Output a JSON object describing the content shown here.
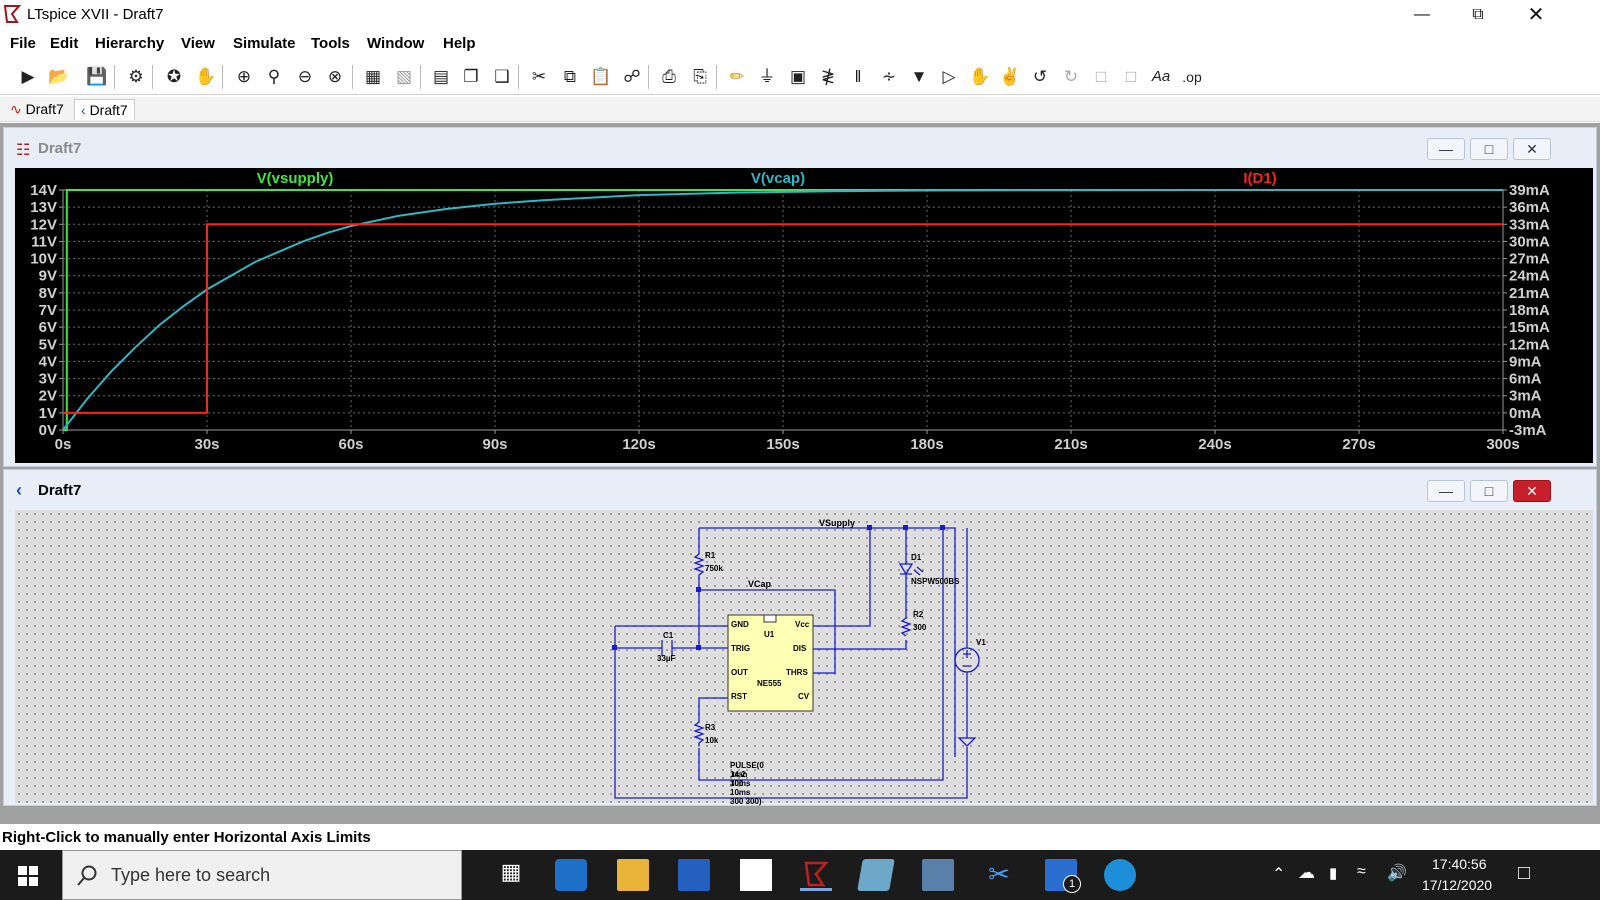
{
  "window": {
    "title": "LTspice XVII - Draft7"
  },
  "menu": [
    "File",
    "Edit",
    "Hierarchy",
    "View",
    "Simulate",
    "Tools",
    "Window",
    "Help"
  ],
  "tabs": [
    {
      "label": "Draft7",
      "kind": "waveform"
    },
    {
      "label": "Draft7",
      "kind": "schematic"
    }
  ],
  "waveform_window": {
    "title": "Draft7"
  },
  "schematic_window": {
    "title": "Draft7"
  },
  "chart_data": {
    "type": "line",
    "series": [
      {
        "name": "V(vsupply)",
        "color": "#3ee83e",
        "axis": "left",
        "x": [
          0,
          0.8,
          0.8,
          300
        ],
        "values": [
          0,
          0,
          14,
          14
        ]
      },
      {
        "name": "V(vcap)",
        "color": "#2fb7c4",
        "axis": "left",
        "x": [
          0,
          5,
          10,
          15,
          20,
          25,
          30,
          35,
          40,
          45,
          50,
          55,
          60,
          70,
          80,
          90,
          100,
          120,
          140,
          160,
          180,
          200,
          240,
          300
        ],
        "values": [
          0,
          1.8,
          3.4,
          4.8,
          6.1,
          7.2,
          8.2,
          9.0,
          9.8,
          10.4,
          11.0,
          11.5,
          11.9,
          12.5,
          12.9,
          13.2,
          13.4,
          13.7,
          13.85,
          13.93,
          13.97,
          13.99,
          14,
          14
        ]
      },
      {
        "name": "I(D1)",
        "color": "#ff2020",
        "axis": "right",
        "x": [
          0,
          0.8,
          0.8,
          30,
          30,
          300
        ],
        "values": [
          0,
          0,
          0,
          0,
          33,
          33
        ]
      }
    ],
    "x_ticks": [
      "0s",
      "30s",
      "60s",
      "90s",
      "120s",
      "150s",
      "180s",
      "210s",
      "240s",
      "270s",
      "300s"
    ],
    "xlim": [
      0,
      300
    ],
    "left_ticks": [
      "14V",
      "13V",
      "12V",
      "11V",
      "10V",
      "9V",
      "8V",
      "7V",
      "6V",
      "5V",
      "4V",
      "3V",
      "2V",
      "1V",
      "0V"
    ],
    "ylim_left": [
      0,
      14
    ],
    "right_ticks": [
      "39mA",
      "36mA",
      "33mA",
      "30mA",
      "27mA",
      "24mA",
      "21mA",
      "18mA",
      "15mA",
      "12mA",
      "9mA",
      "6mA",
      "3mA",
      "0mA",
      "-3mA"
    ],
    "ylim_right": [
      -3,
      39
    ],
    "grid": true,
    "legend": "top"
  },
  "schematic": {
    "labels": {
      "vsupply": "VSupply",
      "vcap": "VCap",
      "r1_name": "R1",
      "r1_val": "750k",
      "r2_name": "R2",
      "r2_val": "300",
      "r3_name": "R3",
      "r3_val": "10k",
      "c1_name": "C1",
      "c1_val": "33µF",
      "d1_name": "D1",
      "d1_val": "NSPW500BS",
      "v1_name": "V1",
      "u1_name": "U1",
      "u1_part": "NE555",
      "pin_gnd": "GND",
      "pin_vcc": "Vcc",
      "pin_trig": "TRIG",
      "pin_dis": "DIS",
      "pin_out": "OUT",
      "pin_thrs": "THRS",
      "pin_rst": "RST",
      "pin_cv": "CV",
      "pulse": "PULSE(0 14 2 10ms 10ms 300 300)",
      "tran": ".tran 300"
    }
  },
  "status": {
    "text": "Right-Click to manually enter Horizontal Axis Limits"
  },
  "taskbar": {
    "search_placeholder": "Type here to search",
    "time": "17:40:56",
    "date": "17/12/2020",
    "mail_badge": "1"
  }
}
